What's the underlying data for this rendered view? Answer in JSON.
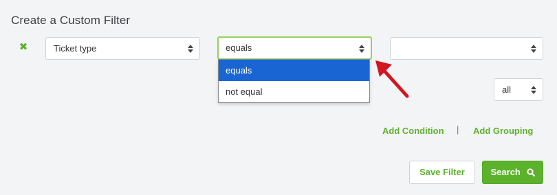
{
  "header": {
    "title": "Create a Custom Filter"
  },
  "condition_row": {
    "remove_icon": "close-icon",
    "field_select": {
      "value": "Ticket type"
    },
    "operator_select": {
      "value": "equals",
      "options": [
        {
          "label": "equals",
          "selected": true
        },
        {
          "label": "not equal",
          "selected": false
        }
      ]
    },
    "value_select": {
      "value": ""
    }
  },
  "match_select": {
    "value": "all"
  },
  "links": {
    "add_condition": "Add Condition",
    "separator": "|",
    "add_grouping": "Add Grouping"
  },
  "buttons": {
    "save_filter": "Save Filter",
    "search": "Search"
  },
  "colors": {
    "accent_green": "#5cb22b",
    "focus_border": "#8fd45c",
    "selected_option": "#1a65d4",
    "annotation_arrow": "#d3161f"
  }
}
